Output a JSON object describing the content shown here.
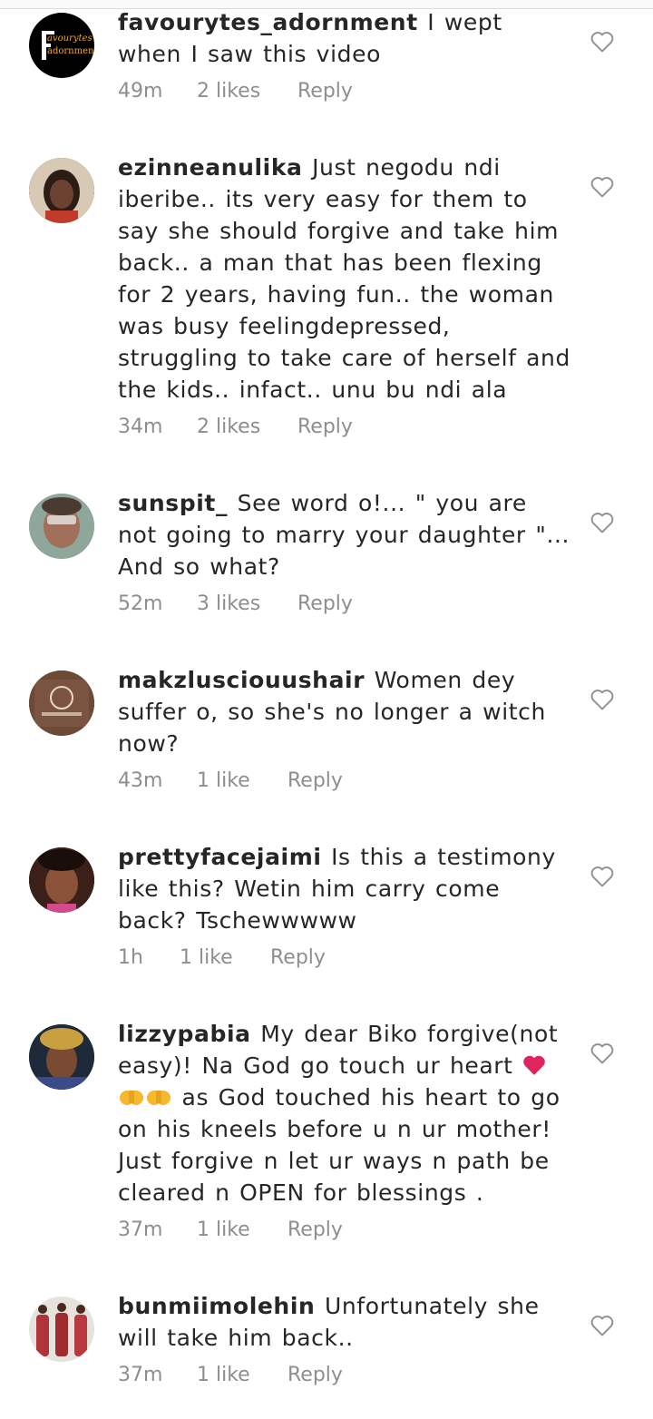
{
  "comments": [
    {
      "username": "favourytes_adornment",
      "text": "I wept when I saw this video",
      "time": "49m",
      "likes": "2 likes",
      "reply": "Reply",
      "avatar": {
        "logo_text_1": "avourytes",
        "logo_text_2": "adornment",
        "logo_letter": "F"
      }
    },
    {
      "username": "ezinneanulika",
      "text": "Just negodu ndi iberibe.. its very easy for them to say she should forgive and take him back.. a man that has been flexing for 2 years, having fun.. the woman was busy feelingdepressed, struggling to take care of herself and the kids.. infact.. unu bu ndi ala",
      "time": "34m",
      "likes": "2 likes",
      "reply": "Reply"
    },
    {
      "username": "sunspit_",
      "text": "See word o!... \" you are not going to marry your daughter \"... And so what?",
      "time": "52m",
      "likes": "3 likes",
      "reply": "Reply"
    },
    {
      "username": "makzlusciouushair",
      "text": "Women dey suffer o, so she's no longer a witch now?",
      "time": "43m",
      "likes": "1 like",
      "reply": "Reply"
    },
    {
      "username": "prettyfacejaimi",
      "text": "Is this a testimony like this? Wetin him carry come back? Tschewwwww",
      "time": "1h",
      "likes": "1 like",
      "reply": "Reply"
    },
    {
      "username": "lizzypabia",
      "text_1": "My dear Biko forgive(not easy)! Na God go touch ur heart",
      "text_2": "as God touched his heart to go on his kneels before u n ur mother! Just forgive n let ur ways n path be cleared n OPEN for blessings .",
      "time": "37m",
      "likes": "1 like",
      "reply": "Reply",
      "emojis": [
        "heart-emoji",
        "pray-emoji",
        "pray-emoji"
      ]
    },
    {
      "username": "bunmiimolehin",
      "text": "Unfortunately she will take him back..",
      "time": "37m",
      "likes": "1 like",
      "reply": "Reply"
    }
  ],
  "colors": {
    "text": "#262626",
    "meta": "#8e8e8e",
    "heart_emoji": "#e0245e"
  }
}
